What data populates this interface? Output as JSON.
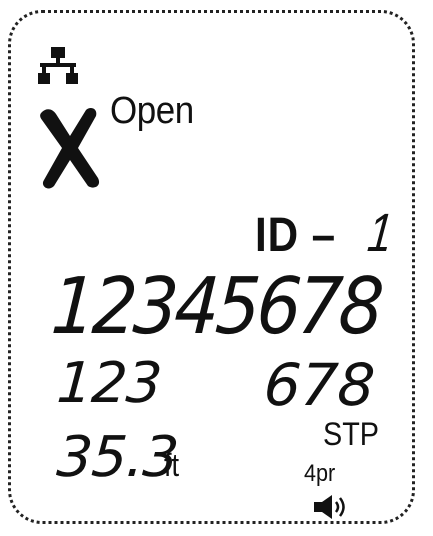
{
  "display": {
    "status": "Open",
    "id_label": "ID –",
    "id_value": "1",
    "pins_top": "12345678",
    "pins_left": "123",
    "pins_right": "678",
    "shield": "STP",
    "length_value": "35.3",
    "length_unit": "ft",
    "pairs": "4pr"
  },
  "icons": {
    "network": "network-icon",
    "fault": "x-fault-icon",
    "speaker": "speaker-icon"
  }
}
